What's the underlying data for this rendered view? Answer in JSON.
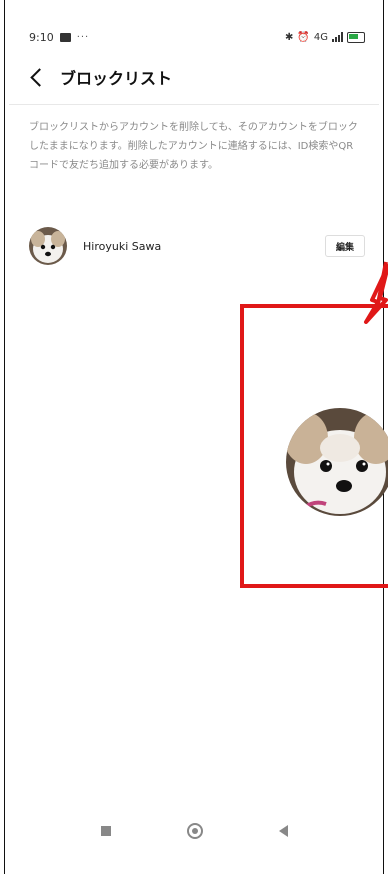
{
  "status_bar": {
    "time": "9:10",
    "notification_dots": "···",
    "network_label": "4G"
  },
  "header": {
    "title": "ブロックリスト"
  },
  "description": "ブロックリストからアカウントを削除しても、そのアカウントをブロックしたままになります。削除したアカウントに連絡するには、ID検索やQRコードで友だち追加する必要があります。",
  "blocked_accounts": [
    {
      "name": "Hiroyuki Sawa",
      "edit_label": "編集"
    }
  ],
  "colors": {
    "annotation": "#e01818",
    "battery": "#2aa845"
  },
  "icons": [
    "back-chevron-icon",
    "bluetooth-icon",
    "alarm-icon",
    "signal-icon",
    "battery-icon",
    "nav-square-icon",
    "nav-home-icon",
    "nav-back-icon"
  ]
}
